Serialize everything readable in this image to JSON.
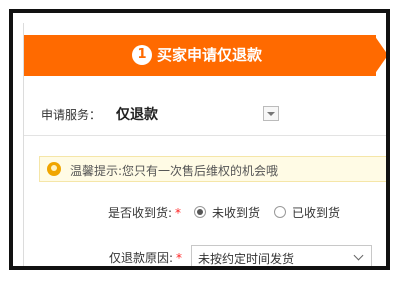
{
  "step": {
    "number": "1",
    "title": "买家申请仅退款"
  },
  "service": {
    "label": "申请服务：",
    "value": "仅退款"
  },
  "tip": {
    "text": "温馨提示:您只有一次售后维权的机会哦"
  },
  "received": {
    "label": "是否收到货:",
    "required_mark": "*",
    "options": [
      {
        "label": "未收到货",
        "checked": true
      },
      {
        "label": "已收到货",
        "checked": false
      }
    ]
  },
  "reason": {
    "label": "仅退款原因:",
    "required_mark": "*",
    "selected": "未按约定时间发货"
  },
  "colors": {
    "accent": "#ff6a00",
    "required": "#ff2222",
    "tip_bg": "#fffbe5"
  }
}
